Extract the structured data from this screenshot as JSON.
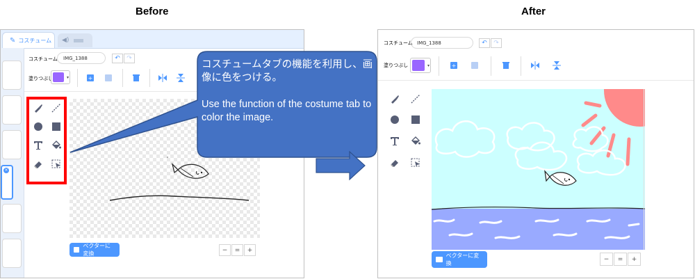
{
  "headings": {
    "before": "Before",
    "after": "After"
  },
  "before": {
    "tabs": [
      {
        "label": "コスチューム"
      },
      {
        "label": ""
      }
    ],
    "costume_label": "コスチューム",
    "costume_name": "IMG_1388",
    "fill_label": "塗りつぶし",
    "convert_button": "ベクターに変換",
    "zoom": {
      "out": "−",
      "reset": "=",
      "in": "+"
    }
  },
  "after": {
    "costume_label": "コスチューム",
    "costume_name": "IMG_1388",
    "fill_label": "塗りつぶし",
    "convert_button": "ベクターに変換",
    "zoom": {
      "out": "−",
      "reset": "=",
      "in": "+"
    }
  },
  "callout": {
    "ja": "コスチュームタブの機能を利用し、画像に色をつける。",
    "en": "Use the function of the costume tab to color the image."
  },
  "colors": {
    "accent": "#4c97ff",
    "fill_swatch": "#9966ff",
    "callout": "#4472c4",
    "highlight": "#ff0000",
    "sky": "#ccffff",
    "sea": "#99aaff",
    "sun": "#ff8a8a"
  },
  "icons": [
    "brush-icon",
    "line-icon",
    "circle-icon",
    "rectangle-icon",
    "text-icon",
    "fill-bucket-icon",
    "eraser-icon",
    "select-icon",
    "undo-icon",
    "redo-icon",
    "group-icon",
    "ungroup-icon",
    "delete-icon",
    "flip-horizontal-icon",
    "flip-vertical-icon",
    "image-icon"
  ]
}
